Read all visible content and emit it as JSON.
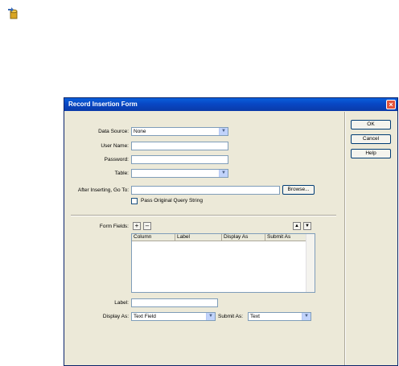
{
  "toolbar": {
    "icon": "record-insertion-icon"
  },
  "dialog": {
    "title": "Record Insertion Form",
    "data_source_label": "Data Source:",
    "data_source_value": "None",
    "user_name_label": "User Name:",
    "user_name_value": "",
    "password_label": "Password:",
    "password_value": "",
    "table_label": "Table:",
    "table_value": "",
    "after_inserting_label": "After Inserting, Go To:",
    "after_inserting_value": "",
    "browse_label": "Browse...",
    "pass_query_label": "Pass Original Query String",
    "form_fields_label": "Form Fields:",
    "add_symbol": "+",
    "remove_symbol": "–",
    "columns": [
      "Column",
      "Label",
      "Display As",
      "Submit As"
    ],
    "label_label": "Label:",
    "label_value": "",
    "display_as_label": "Display As:",
    "display_as_value": "Text Field",
    "submit_as_label": "Submit As:",
    "submit_as_value": "Text",
    "ok_label": "OK",
    "cancel_label": "Cancel",
    "help_label": "Help"
  },
  "colors": {
    "titlebar": "#0a4cc4",
    "dialog_bg": "#ece9d8",
    "close": "#e2533a"
  }
}
